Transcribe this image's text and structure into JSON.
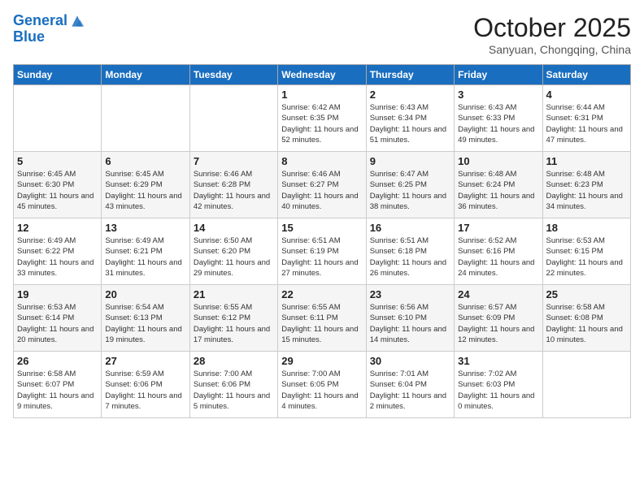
{
  "header": {
    "logo_line1": "General",
    "logo_line2": "Blue",
    "month_title": "October 2025",
    "subtitle": "Sanyuan, Chongqing, China"
  },
  "weekdays": [
    "Sunday",
    "Monday",
    "Tuesday",
    "Wednesday",
    "Thursday",
    "Friday",
    "Saturday"
  ],
  "weeks": [
    [
      {
        "day": "",
        "content": ""
      },
      {
        "day": "",
        "content": ""
      },
      {
        "day": "",
        "content": ""
      },
      {
        "day": "1",
        "content": "Sunrise: 6:42 AM\nSunset: 6:35 PM\nDaylight: 11 hours and 52 minutes."
      },
      {
        "day": "2",
        "content": "Sunrise: 6:43 AM\nSunset: 6:34 PM\nDaylight: 11 hours and 51 minutes."
      },
      {
        "day": "3",
        "content": "Sunrise: 6:43 AM\nSunset: 6:33 PM\nDaylight: 11 hours and 49 minutes."
      },
      {
        "day": "4",
        "content": "Sunrise: 6:44 AM\nSunset: 6:31 PM\nDaylight: 11 hours and 47 minutes."
      }
    ],
    [
      {
        "day": "5",
        "content": "Sunrise: 6:45 AM\nSunset: 6:30 PM\nDaylight: 11 hours and 45 minutes."
      },
      {
        "day": "6",
        "content": "Sunrise: 6:45 AM\nSunset: 6:29 PM\nDaylight: 11 hours and 43 minutes."
      },
      {
        "day": "7",
        "content": "Sunrise: 6:46 AM\nSunset: 6:28 PM\nDaylight: 11 hours and 42 minutes."
      },
      {
        "day": "8",
        "content": "Sunrise: 6:46 AM\nSunset: 6:27 PM\nDaylight: 11 hours and 40 minutes."
      },
      {
        "day": "9",
        "content": "Sunrise: 6:47 AM\nSunset: 6:25 PM\nDaylight: 11 hours and 38 minutes."
      },
      {
        "day": "10",
        "content": "Sunrise: 6:48 AM\nSunset: 6:24 PM\nDaylight: 11 hours and 36 minutes."
      },
      {
        "day": "11",
        "content": "Sunrise: 6:48 AM\nSunset: 6:23 PM\nDaylight: 11 hours and 34 minutes."
      }
    ],
    [
      {
        "day": "12",
        "content": "Sunrise: 6:49 AM\nSunset: 6:22 PM\nDaylight: 11 hours and 33 minutes."
      },
      {
        "day": "13",
        "content": "Sunrise: 6:49 AM\nSunset: 6:21 PM\nDaylight: 11 hours and 31 minutes."
      },
      {
        "day": "14",
        "content": "Sunrise: 6:50 AM\nSunset: 6:20 PM\nDaylight: 11 hours and 29 minutes."
      },
      {
        "day": "15",
        "content": "Sunrise: 6:51 AM\nSunset: 6:19 PM\nDaylight: 11 hours and 27 minutes."
      },
      {
        "day": "16",
        "content": "Sunrise: 6:51 AM\nSunset: 6:18 PM\nDaylight: 11 hours and 26 minutes."
      },
      {
        "day": "17",
        "content": "Sunrise: 6:52 AM\nSunset: 6:16 PM\nDaylight: 11 hours and 24 minutes."
      },
      {
        "day": "18",
        "content": "Sunrise: 6:53 AM\nSunset: 6:15 PM\nDaylight: 11 hours and 22 minutes."
      }
    ],
    [
      {
        "day": "19",
        "content": "Sunrise: 6:53 AM\nSunset: 6:14 PM\nDaylight: 11 hours and 20 minutes."
      },
      {
        "day": "20",
        "content": "Sunrise: 6:54 AM\nSunset: 6:13 PM\nDaylight: 11 hours and 19 minutes."
      },
      {
        "day": "21",
        "content": "Sunrise: 6:55 AM\nSunset: 6:12 PM\nDaylight: 11 hours and 17 minutes."
      },
      {
        "day": "22",
        "content": "Sunrise: 6:55 AM\nSunset: 6:11 PM\nDaylight: 11 hours and 15 minutes."
      },
      {
        "day": "23",
        "content": "Sunrise: 6:56 AM\nSunset: 6:10 PM\nDaylight: 11 hours and 14 minutes."
      },
      {
        "day": "24",
        "content": "Sunrise: 6:57 AM\nSunset: 6:09 PM\nDaylight: 11 hours and 12 minutes."
      },
      {
        "day": "25",
        "content": "Sunrise: 6:58 AM\nSunset: 6:08 PM\nDaylight: 11 hours and 10 minutes."
      }
    ],
    [
      {
        "day": "26",
        "content": "Sunrise: 6:58 AM\nSunset: 6:07 PM\nDaylight: 11 hours and 9 minutes."
      },
      {
        "day": "27",
        "content": "Sunrise: 6:59 AM\nSunset: 6:06 PM\nDaylight: 11 hours and 7 minutes."
      },
      {
        "day": "28",
        "content": "Sunrise: 7:00 AM\nSunset: 6:06 PM\nDaylight: 11 hours and 5 minutes."
      },
      {
        "day": "29",
        "content": "Sunrise: 7:00 AM\nSunset: 6:05 PM\nDaylight: 11 hours and 4 minutes."
      },
      {
        "day": "30",
        "content": "Sunrise: 7:01 AM\nSunset: 6:04 PM\nDaylight: 11 hours and 2 minutes."
      },
      {
        "day": "31",
        "content": "Sunrise: 7:02 AM\nSunset: 6:03 PM\nDaylight: 11 hours and 0 minutes."
      },
      {
        "day": "",
        "content": ""
      }
    ]
  ]
}
